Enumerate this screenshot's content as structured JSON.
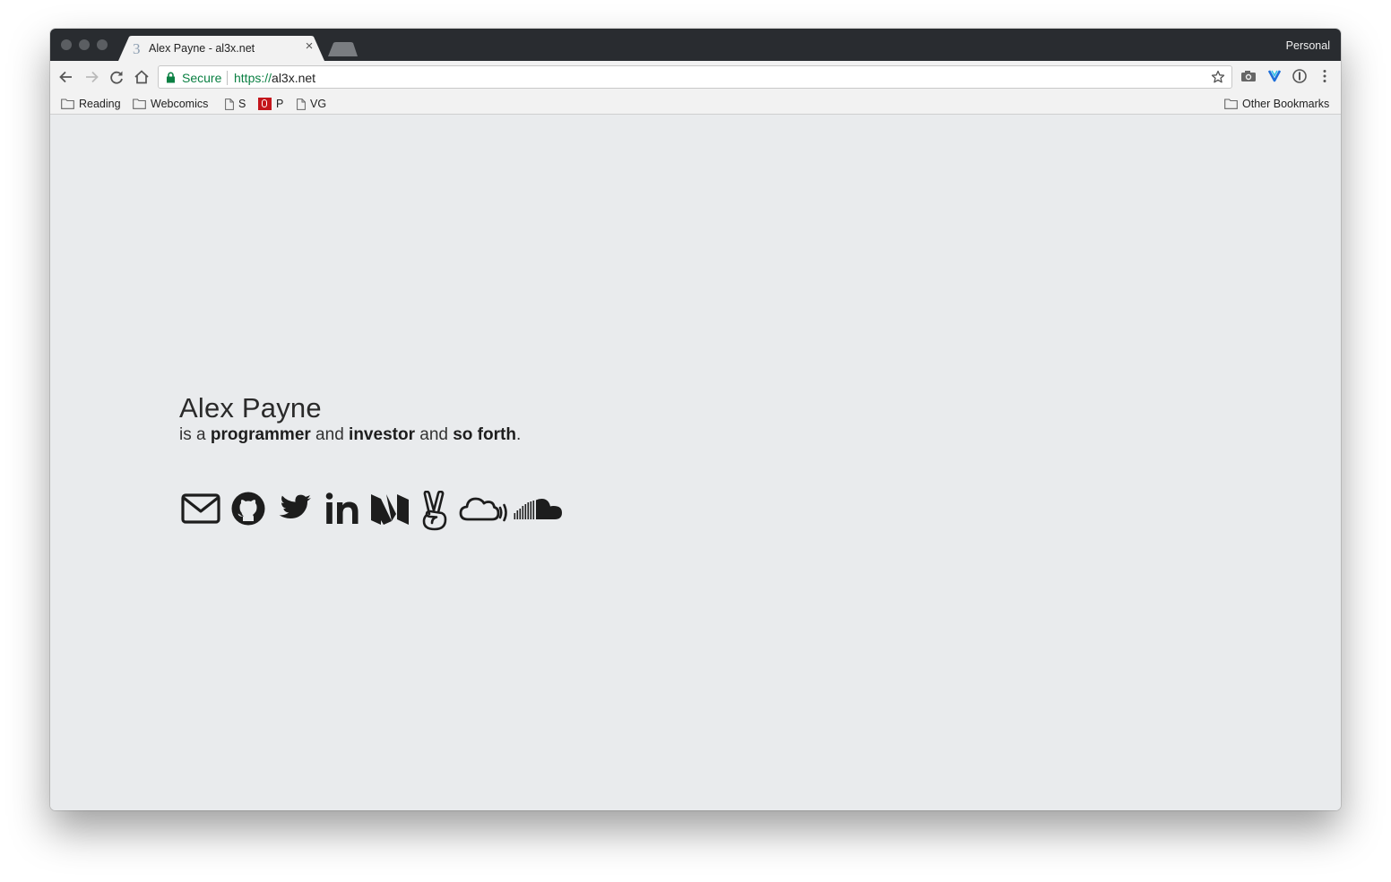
{
  "tab": {
    "favicon": "3",
    "title": "Alex Payne - al3x.net",
    "close": "×"
  },
  "profile": "Personal",
  "omnibox": {
    "secure_label": "Secure",
    "url_scheme": "https://",
    "url_host": "al3x.net"
  },
  "bookmarks": {
    "left": [
      {
        "icon": "folder-icon",
        "label": "Reading"
      },
      {
        "icon": "folder-icon",
        "label": "Webcomics"
      },
      {
        "icon": "page-icon",
        "label": "S"
      },
      {
        "icon": "pinboard-icon",
        "label": "P"
      },
      {
        "icon": "page-icon",
        "label": "VG"
      }
    ],
    "right": {
      "icon": "folder-icon",
      "label": "Other Bookmarks"
    }
  },
  "page": {
    "name": "Alex Payne",
    "tagline": {
      "prefix": "is a ",
      "role1": "programmer",
      "and1": " and ",
      "role2": "investor",
      "and2": " and ",
      "role3": "so forth",
      "suffix": "."
    },
    "social_icons": [
      "email-icon",
      "github-icon",
      "twitter-icon",
      "linkedin-icon",
      "medium-icon",
      "angellist-icon",
      "cloud-podcast-icon",
      "soundcloud-icon"
    ]
  },
  "colors": {
    "titlebar": "#292c30",
    "toolbar": "#f2f2f2",
    "page_background": "#e9ebed",
    "secure_green": "#0b8043",
    "text": "#2a2a2a"
  }
}
